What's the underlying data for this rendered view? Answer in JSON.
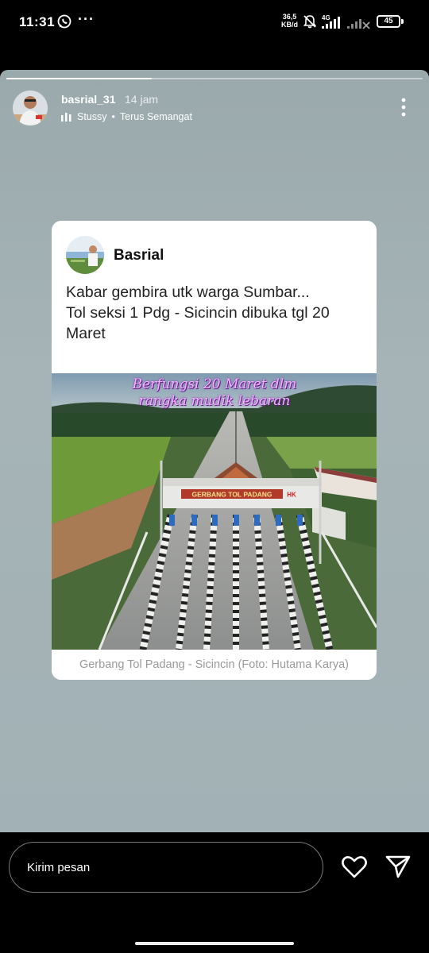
{
  "status_bar": {
    "time": "11:31",
    "dots": "···",
    "speed_value": "36,5",
    "speed_unit": "KB/d",
    "network": "4G",
    "battery": "45"
  },
  "story": {
    "progress": 0.35,
    "username": "basrial_31",
    "time_ago": "14 jam",
    "music_artist": "Stussy",
    "music_separator": "•",
    "music_title": "Terus Semangat"
  },
  "card": {
    "author": "Basrial",
    "text_line1": "Kabar gembira utk warga Sumbar...",
    "text_line2": "Tol seksi 1 Pdg - Sicincin dibuka tgl 20",
    "text_line3": "Maret",
    "photo_overlay_line1": "Berfungsi 20 Maret dlm",
    "photo_overlay_line2": "rangka mudik lebaran",
    "gate_sign": "GERBANG TOL PADANG",
    "gate_logo": "HK",
    "caption": "Gerbang Tol Padang - Sicincin (Foto: Hutama Karya)"
  },
  "bottom_bar": {
    "message_placeholder": "Kirim pesan"
  },
  "icons": {
    "whatsapp": "whatsapp-icon",
    "mute": "bell-off-icon",
    "more": "more-vertical-icon",
    "heart": "heart-icon",
    "send": "send-icon"
  },
  "colors": {
    "story_bg": "#a2b1b5",
    "overlay_text": "#f2b6ff"
  }
}
